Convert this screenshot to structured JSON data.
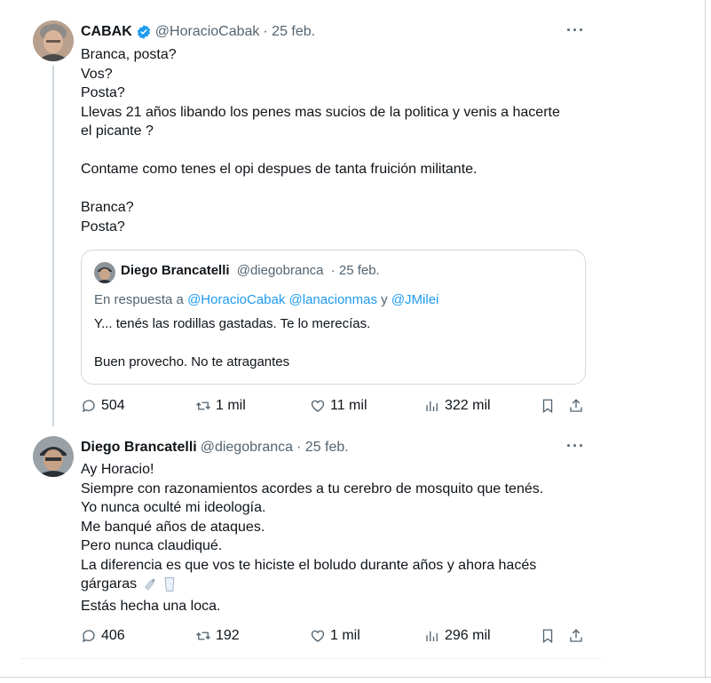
{
  "tweet1": {
    "name": "CABAK",
    "handle": "@HoracioCabak",
    "date": "· 25 feb.",
    "more": "···",
    "text": "Branca, posta?\nVos?\nPosta?\nLlevas 21 años libando los penes mas sucios de la politica y venis a hacerte\nel picante ?\n\nContame como tenes el opi despues de tanta fruición militante.\n\nBranca?\nPosta?",
    "quote": {
      "name": "Diego Brancatelli",
      "handle": "@diegobranca",
      "date": "· 25 feb.",
      "reply_prefix": "En respuesta a",
      "reply_to": "@HoracioCabak @lanacionmas",
      "reply_and": "y",
      "reply_last": "@JMilei",
      "text1": "Y... tenés las rodillas gastadas. Te lo merecías.",
      "text2": "Buen provecho. No te atragantes"
    },
    "actions": {
      "replies": "504",
      "retweets": "1 mil",
      "likes": "11 mil",
      "views": "322 mil"
    }
  },
  "tweet2": {
    "name": "Diego Brancatelli",
    "handle": "@diegobranca",
    "date": "· 25 feb.",
    "more": "···",
    "text": "Ay Horacio!\nSiempre con razonamientos acordes a tu cerebro de mosquito que tenés.\nYo nunca oculté mi ideología.\nMe banqué años de ataques.\nPero nunca claudiqué.\nLa diferencia es que vos te hiciste el boludo durante años y ahora hacés",
    "text_last_line": "gárgaras",
    "text_end": "Estás hecha una loca.",
    "actions": {
      "replies": "406",
      "retweets": "192",
      "likes": "1 mil",
      "views": "296 mil"
    }
  },
  "colors": {
    "accent": "#1d9bf0",
    "secondary_text": "#536471",
    "border": "#cfd9de"
  }
}
